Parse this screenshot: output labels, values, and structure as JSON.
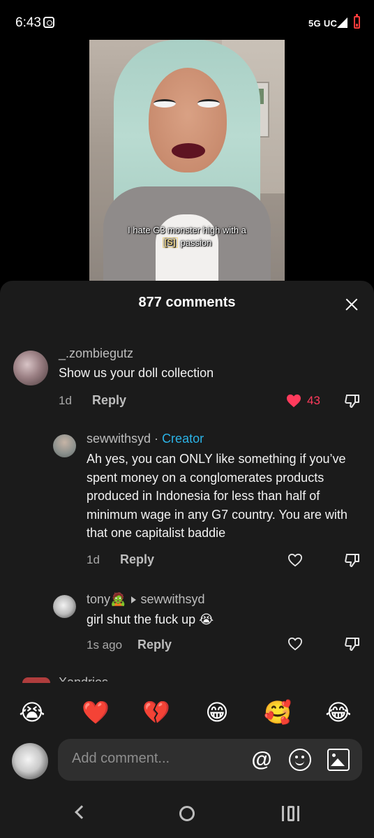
{
  "status_bar": {
    "time": "6:43",
    "network": "5G UC"
  },
  "video": {
    "caption_line1": "I hate G3 monster high with a",
    "caption_sticker": "[S]",
    "caption_line2": "passion"
  },
  "sheet": {
    "title": "877 comments"
  },
  "comments": [
    {
      "username": "_.zombiegutz",
      "text": "Show us your doll collection",
      "time": "1d",
      "reply_label": "Reply",
      "likes": "43",
      "liked": true
    },
    {
      "username": "sewwithsyd",
      "separator": "·",
      "badge": "Creator",
      "text": "Ah yes, you can ONLY like something if you’ve spent money on a conglomerates products produced in Indonesia for less than half of minimum wage in any G7 country. You are with that one capitalist baddie",
      "time": "1d",
      "reply_label": "Reply"
    },
    {
      "username": "tony🧟",
      "reply_to": "sewwithsyd",
      "text": "girl shut the fuck up 😭",
      "time": "1s ago",
      "reply_label": "Reply"
    }
  ],
  "peek_comment": {
    "username": "Xandrios"
  },
  "emoji_bar": [
    "😭",
    "❤️",
    "💔",
    "😁",
    "🥰",
    "😂"
  ],
  "input": {
    "placeholder": "Add comment...",
    "mention_icon": "@"
  },
  "colors": {
    "accent_creator": "#2bb3e6",
    "like_red": "#ff3b5c",
    "sheet_bg": "#1b1b1b"
  }
}
